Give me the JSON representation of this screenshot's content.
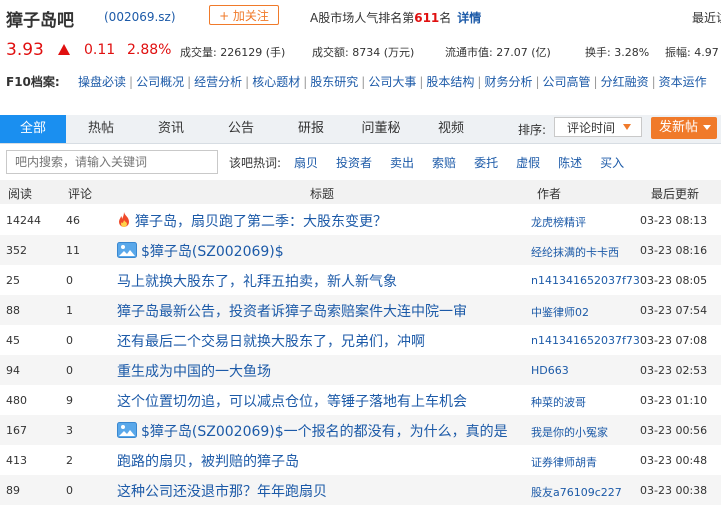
{
  "header": {
    "title": "獐子岛吧",
    "code": "(002069.sz)",
    "follow_label": "+ 加关注",
    "rank_prefix": "A股市场人气排名第",
    "rank_num": "611",
    "rank_suffix": "名",
    "rank_detail": "详情",
    "recent": "最近访"
  },
  "quote": {
    "price": "3.93",
    "change": "0.11",
    "change_pct": "2.88%",
    "volume": "成交量: 226129 (手)",
    "turnover": "成交额: 8734 (万元)",
    "float_cap": "流通市值: 27.07 (亿)",
    "turnover_rate": "换手: 3.28%",
    "amplitude": "振幅: 4.97",
    "up_color": "#e01010"
  },
  "f10": {
    "label": "F10档案:",
    "links": [
      "操盘必读",
      "公司概况",
      "经营分析",
      "核心题材",
      "股东研究",
      "公司大事",
      "股本结构",
      "财务分析",
      "公司高管",
      "分红融资",
      "资本运作"
    ]
  },
  "tabs": [
    "全部",
    "热帖",
    "资讯",
    "公告",
    "研报",
    "问董秘",
    "视频"
  ],
  "sort": {
    "label": "排序:",
    "value": "评论时间"
  },
  "post_button": "发新帖",
  "search": {
    "placeholder": "吧内搜索，请输入关键词"
  },
  "hot": {
    "label": "该吧热词:",
    "words": [
      "扇贝",
      "投资者",
      "卖出",
      "索赔",
      "委托",
      "虚假",
      "陈述",
      "买入"
    ]
  },
  "table": {
    "headers": {
      "read": "阅读",
      "comment": "评论",
      "title": "标题",
      "author": "作者",
      "updated": "最后更新"
    },
    "rows": [
      {
        "read": "14244",
        "comment": "46",
        "icon": "fire-icon",
        "title": "獐子岛，扇贝跑了第二季：大股东变更？",
        "author": "龙虎榜精评",
        "date": "03-23 08:13"
      },
      {
        "read": "352",
        "comment": "11",
        "icon": "image-icon",
        "title": "$獐子岛(SZ002069)$",
        "author": "经纶抹满的卡卡西",
        "date": "03-23 08:16"
      },
      {
        "read": "25",
        "comment": "0",
        "icon": "",
        "title": "马上就换大股东了，礼拜五拍卖，新人新气象",
        "author": "n141341652037f73",
        "date": "03-23 08:05"
      },
      {
        "read": "88",
        "comment": "1",
        "icon": "",
        "title": "獐子岛最新公告，投资者诉獐子岛索赔案件大连中院一审",
        "author": "中鉴律师02",
        "date": "03-23 07:54"
      },
      {
        "read": "45",
        "comment": "0",
        "icon": "",
        "title": "还有最后二个交易日就换大股东了，兄弟们，冲啊",
        "author": "n141341652037f73",
        "date": "03-23 07:08"
      },
      {
        "read": "94",
        "comment": "0",
        "icon": "",
        "title": "重生成为中国的一大鱼场",
        "author": "HD663",
        "date": "03-23 02:53"
      },
      {
        "read": "480",
        "comment": "9",
        "icon": "",
        "title": "这个位置切勿追，可以减点仓位，等锤子落地有上车机会",
        "author": "种菜的波哥",
        "date": "03-23 01:10"
      },
      {
        "read": "167",
        "comment": "3",
        "icon": "image-icon",
        "title": "$獐子岛(SZ002069)$一个报名的都没有，为什么，真的是",
        "author": "我是你的小冤家",
        "date": "03-23 00:56"
      },
      {
        "read": "413",
        "comment": "2",
        "icon": "",
        "title": "跑路的扇贝，被判赔的獐子岛",
        "author": "证券律师胡青",
        "date": "03-23 00:48"
      },
      {
        "read": "89",
        "comment": "0",
        "icon": "",
        "title": "这种公司还没退市那？年年跑扇贝",
        "author": "股友a76109c227",
        "date": "03-23 00:38"
      }
    ]
  }
}
